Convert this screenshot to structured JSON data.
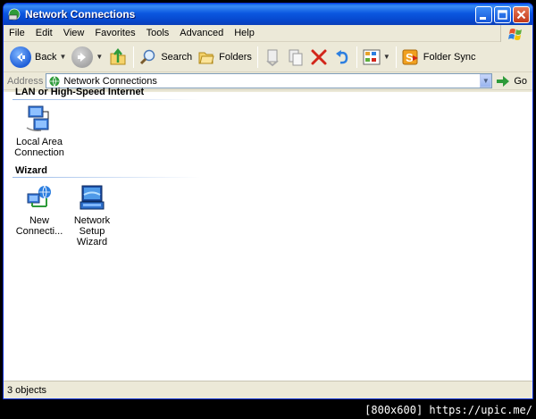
{
  "window": {
    "title": "Network Connections"
  },
  "menu": [
    "File",
    "Edit",
    "View",
    "Favorites",
    "Tools",
    "Advanced",
    "Help"
  ],
  "toolbar": {
    "back_label": "Back",
    "search_label": "Search",
    "folders_label": "Folders",
    "foldersync_label": "Folder Sync"
  },
  "address": {
    "label": "Address",
    "value": "Network Connections",
    "go_label": "Go"
  },
  "groups": [
    {
      "title": "LAN or High-Speed Internet",
      "items": [
        {
          "line1": "Local Area",
          "line2": "Connection"
        }
      ]
    },
    {
      "title": "Wizard",
      "items": [
        {
          "line1": "New",
          "line2": "Connecti..."
        },
        {
          "line1": "Network Setup",
          "line2": "Wizard"
        }
      ]
    }
  ],
  "status": {
    "text": "3 objects"
  },
  "watermark": "[800x600] https://upic.me/"
}
